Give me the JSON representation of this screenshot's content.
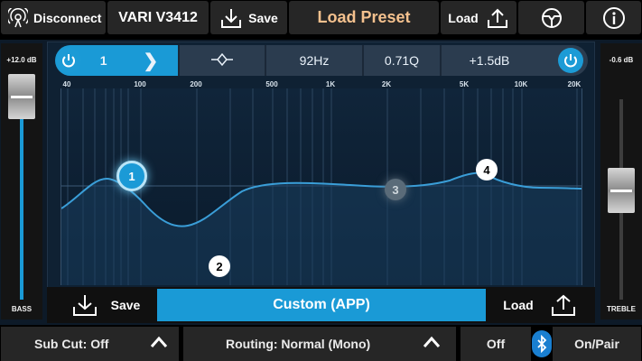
{
  "header": {
    "disconnect_label": "Disconnect",
    "device_name": "VARI V3412",
    "save_label": "Save",
    "load_preset_label": "Load Preset",
    "load_label": "Load"
  },
  "eq_toolbar": {
    "band_number": "1",
    "frequency": "92Hz",
    "q": "0.71Q",
    "gain": "+1.5dB"
  },
  "freq_axis": [
    "40",
    "100",
    "200",
    "500",
    "1K",
    "2K",
    "5K",
    "10K",
    "20K"
  ],
  "nodes": [
    "1",
    "2",
    "3",
    "4"
  ],
  "bass": {
    "level": "+12.0 dB",
    "label": "BASS"
  },
  "treble": {
    "level": "-0.6 dB",
    "label": "TREBLE"
  },
  "bottom_bar": {
    "save_label": "Save",
    "preset_name": "Custom (APP)",
    "load_label": "Load"
  },
  "footer": {
    "subcut": "Sub Cut: Off",
    "routing": "Routing: Normal (Mono)",
    "off_label": "Off",
    "onpair_label": "On/Pair"
  },
  "colors": {
    "accent": "#1a9ad6",
    "preset_title": "#f4c18e",
    "panel": "#0f2133"
  }
}
